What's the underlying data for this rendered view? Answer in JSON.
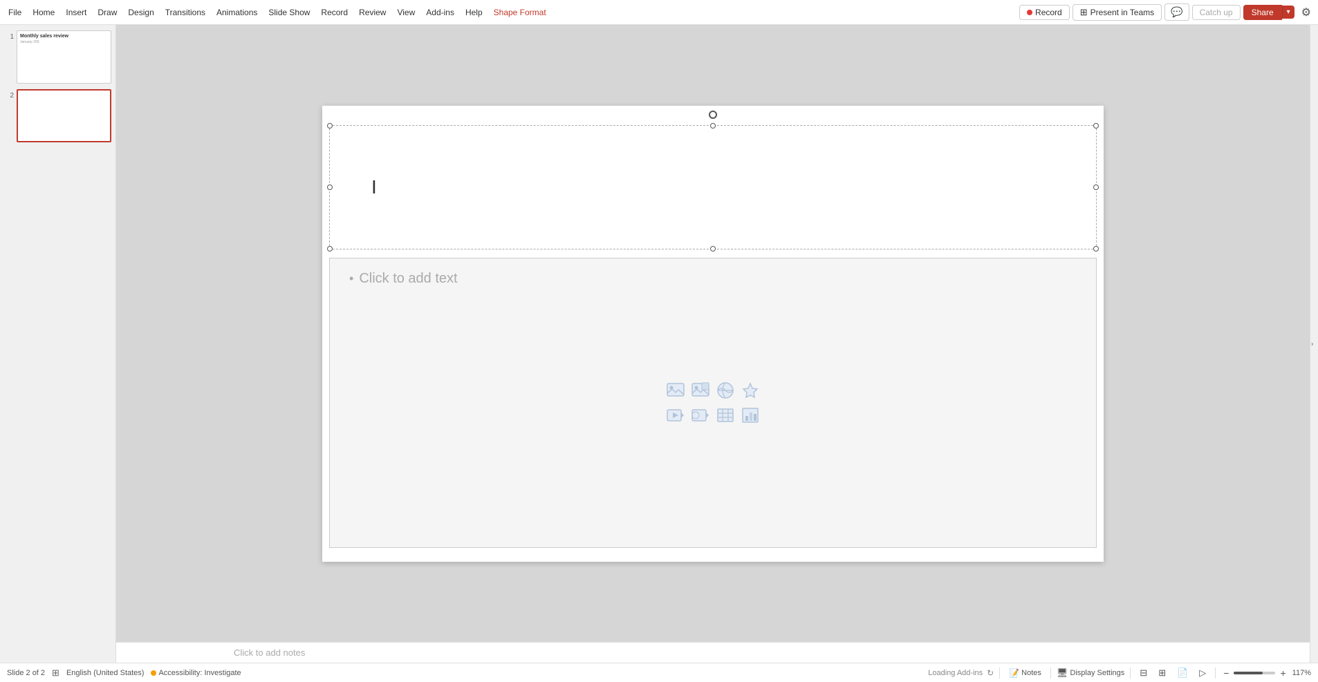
{
  "menubar": {
    "items": [
      "File",
      "Home",
      "Insert",
      "Draw",
      "Design",
      "Transitions",
      "Animations",
      "Slide Show",
      "Record",
      "Review",
      "View",
      "Add-ins",
      "Help",
      "Shape Format"
    ],
    "active_item": "Shape Format",
    "record_label": "Record",
    "present_label": "Present in Teams",
    "catchup_label": "Catch up",
    "share_label": "Share"
  },
  "slides": [
    {
      "number": "1",
      "title": "Monthly sales review",
      "subtitle": "January 200"
    },
    {
      "number": "2",
      "title": "",
      "subtitle": ""
    }
  ],
  "canvas": {
    "title_placeholder": "",
    "content_placeholder": "• Click to add text",
    "click_prompt": "Click to add text"
  },
  "statusbar": {
    "slide_info": "Slide 2 of 2",
    "language": "English (United States)",
    "accessibility": "Accessibility: Investigate",
    "loading": "Loading Add-ins",
    "notes": "Notes",
    "display_settings": "Display Settings",
    "zoom": "117%"
  },
  "notes_area": {
    "placeholder": "Click to add notes"
  },
  "icons": {
    "record_dot": "●",
    "comment": "💬",
    "share_caret": "▾",
    "collapse": "›",
    "notes_icon": "📝",
    "display_icon": "🖥",
    "zoom_minus": "−",
    "zoom_plus": "+"
  }
}
